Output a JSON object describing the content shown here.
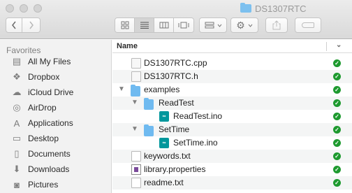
{
  "window": {
    "title": "DS1307RTC"
  },
  "toolbar": {
    "back_icon": "chevron-left-icon",
    "forward_icon": "chevron-right-icon"
  },
  "sidebar": {
    "header": "Favorites",
    "items": [
      {
        "label": "All My Files",
        "icon": "all-files-icon",
        "glyph": "▤"
      },
      {
        "label": "Dropbox",
        "icon": "dropbox-icon",
        "glyph": "❖"
      },
      {
        "label": "iCloud Drive",
        "icon": "cloud-icon",
        "glyph": "☁"
      },
      {
        "label": "AirDrop",
        "icon": "airdrop-icon",
        "glyph": "◎"
      },
      {
        "label": "Applications",
        "icon": "applications-icon",
        "glyph": "A"
      },
      {
        "label": "Desktop",
        "icon": "desktop-icon",
        "glyph": "▭"
      },
      {
        "label": "Documents",
        "icon": "documents-icon",
        "glyph": "▯"
      },
      {
        "label": "Downloads",
        "icon": "downloads-icon",
        "glyph": "⬇"
      },
      {
        "label": "Pictures",
        "icon": "camera-icon",
        "glyph": "◙"
      }
    ]
  },
  "list": {
    "header_name": "Name",
    "rows": [
      {
        "label": "DS1307RTC.cpp",
        "kind": "code"
      },
      {
        "label": "DS1307RTC.h",
        "kind": "code"
      },
      {
        "label": "examples",
        "kind": "folder",
        "expanded": true
      },
      {
        "label": "ReadTest",
        "kind": "folder",
        "expanded": true
      },
      {
        "label": "ReadTest.ino",
        "kind": "ino"
      },
      {
        "label": "SetTime",
        "kind": "folder",
        "expanded": true
      },
      {
        "label": "SetTime.ino",
        "kind": "ino"
      },
      {
        "label": "keywords.txt",
        "kind": "text"
      },
      {
        "label": "library.properties",
        "kind": "properties"
      },
      {
        "label": "readme.txt",
        "kind": "text"
      }
    ]
  },
  "colors": {
    "sync_green": "#1e9a2f",
    "folder_blue": "#6fbaf0",
    "arduino_teal": "#00979c"
  }
}
